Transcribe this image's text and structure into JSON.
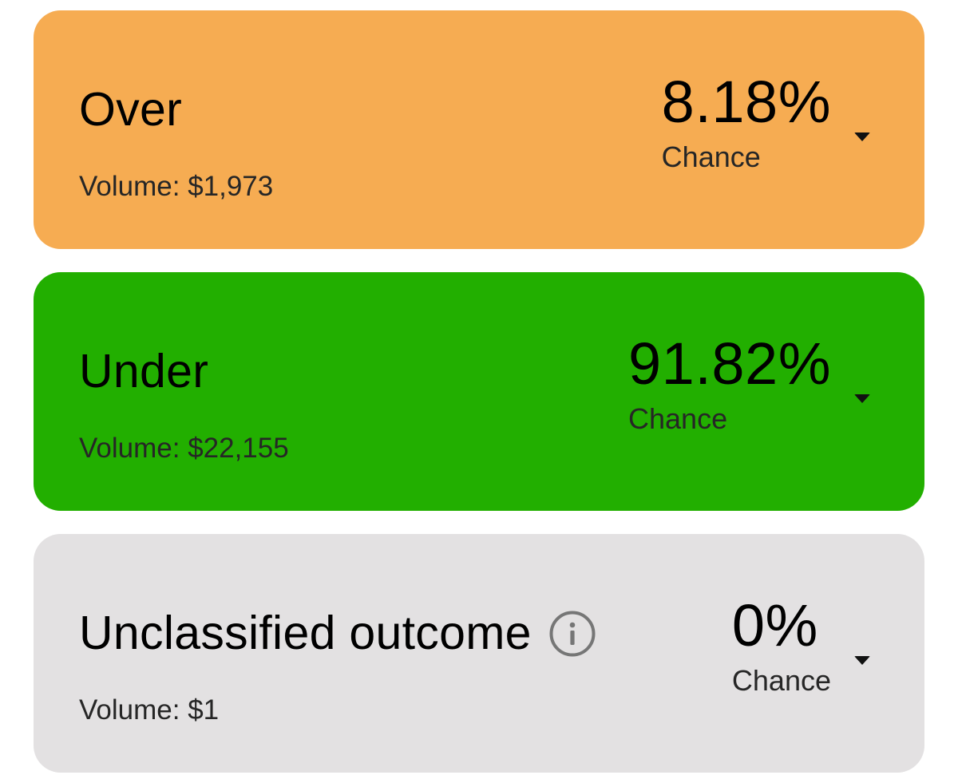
{
  "outcomes": [
    {
      "name": "Over",
      "volume": "Volume: $1,973",
      "percent": "8.18%",
      "chance_label": "Chance",
      "bg_color": "#F6AC52",
      "has_info": false
    },
    {
      "name": "Under",
      "volume": "Volume: $22,155",
      "percent": "91.82%",
      "chance_label": "Chance",
      "bg_color": "#22AF00",
      "has_info": false
    },
    {
      "name": "Unclassified outcome",
      "volume": "Volume: $1",
      "percent": "0%",
      "chance_label": "Chance",
      "bg_color": "#E3E1E2",
      "has_info": true,
      "info_icon": "info-icon"
    }
  ],
  "icons": {
    "expand": "chevron-down-icon",
    "info": "info-icon"
  }
}
